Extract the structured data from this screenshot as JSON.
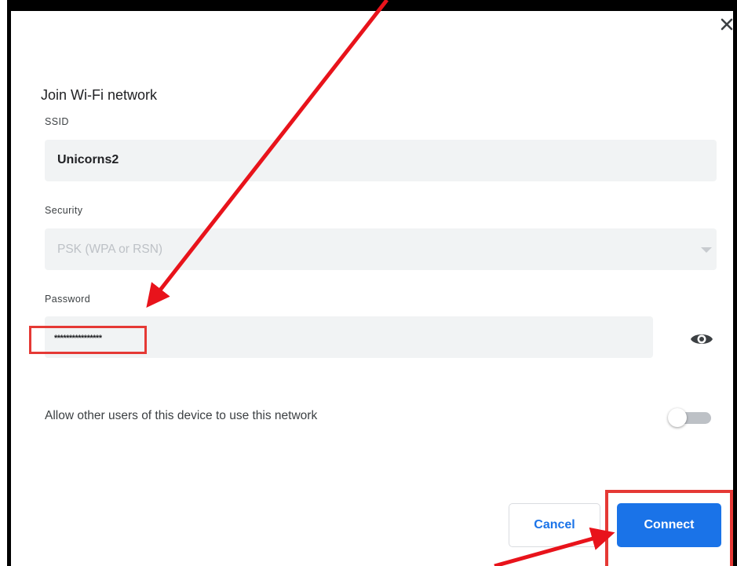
{
  "dialog": {
    "title": "Join Wi-Fi network",
    "close_label": "×"
  },
  "ssid": {
    "label": "SSID",
    "value": "Unicorns2"
  },
  "security": {
    "label": "Security",
    "value": "PSK (WPA or RSN)"
  },
  "password": {
    "label": "Password",
    "value": "****************",
    "toggle_icon": "eye-icon"
  },
  "share": {
    "label": "Allow other users of this device to use this network",
    "enabled": false
  },
  "buttons": {
    "cancel_label": "Cancel",
    "connect_label": "Connect"
  },
  "colors": {
    "accent": "#1a73e8",
    "annotation": "#e53935",
    "input_bg": "#f1f3f4"
  }
}
